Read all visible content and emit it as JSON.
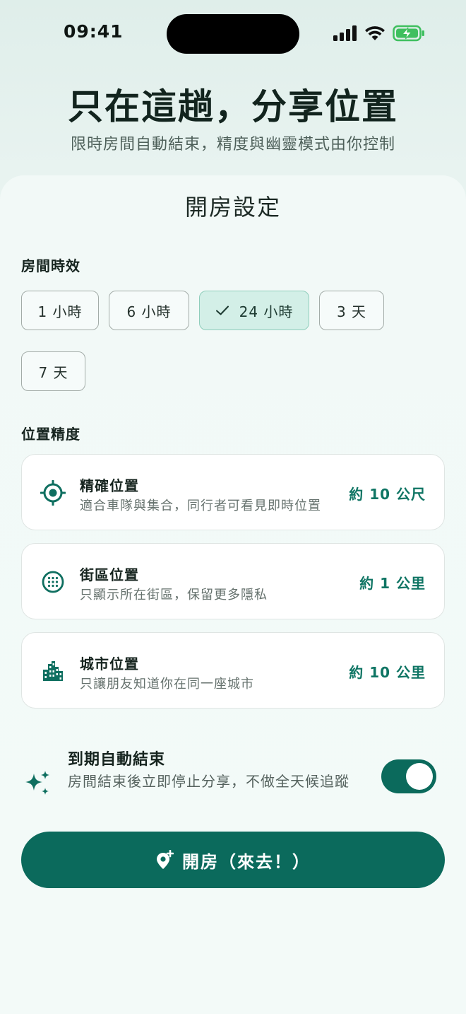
{
  "status_bar": {
    "time": "09:41",
    "icons": [
      "signal-icon",
      "wifi-icon",
      "battery-charging-icon"
    ],
    "battery_color": "#3fbf5f"
  },
  "hero": {
    "title": "只在這趟，分享位置",
    "subtitle": "限時房間自動結束，精度與幽靈模式由你控制"
  },
  "sheet": {
    "title": "開房設定",
    "duration": {
      "label": "房間時效",
      "options": [
        {
          "label": "1 小時",
          "selected": false
        },
        {
          "label": "6 小時",
          "selected": false
        },
        {
          "label": "24 小時",
          "selected": true
        },
        {
          "label": "3 天",
          "selected": false
        },
        {
          "label": "7 天",
          "selected": false
        }
      ]
    },
    "precision": {
      "label": "位置精度",
      "options": [
        {
          "icon": "crosshair-icon",
          "title": "精確位置",
          "desc": "適合車隊與集合，同行者可看見即時位置",
          "value": "約 10 公尺"
        },
        {
          "icon": "grid-circle-icon",
          "title": "街區位置",
          "desc": "只顯示所在街區，保留更多隱私",
          "value": "約 1 公里"
        },
        {
          "icon": "city-icon",
          "title": "城市位置",
          "desc": "只讓朋友知道你在同一座城市",
          "value": "約 10 公里"
        }
      ]
    },
    "auto_end": {
      "icon": "sparkle-icon",
      "title": "到期自動結束",
      "desc": "房間結束後立即停止分享，不做全天候追蹤",
      "enabled": true
    },
    "cta": {
      "icon": "location-pin-add-icon",
      "label": "開房（來去！）"
    }
  },
  "colors": {
    "accent": "#0b6a5c",
    "accent_text": "#0f7564",
    "chip_selected_bg": "#d3efe7"
  }
}
